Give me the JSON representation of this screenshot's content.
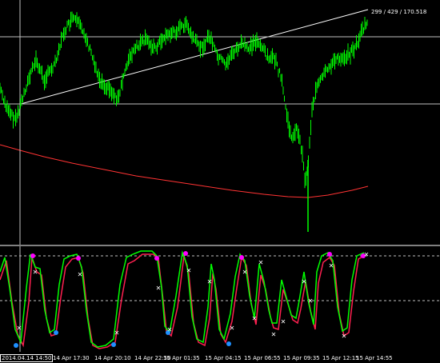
{
  "crosshair": {
    "readout": "299 / 429 / 170.518"
  },
  "time_axis": {
    "labels": [
      "2014.04.14 14:50",
      "14 Apr 17:30",
      "14 Apr 20:10",
      "14 Apr 22:50",
      "15 Apr 01:35",
      "15 Apr 04:15",
      "15 Apr 06:55",
      "15 Apr 09:35",
      "15 Apr 12:15",
      "15 Apr 14:55"
    ]
  },
  "colors": {
    "background": "#000000",
    "price_bars": "#00ff00",
    "moving_average": "#ff3333",
    "crosshair": "#c0c0c0",
    "trendline": "#ffffff",
    "osc_fast": "#00ff00",
    "osc_slow": "#ff2050",
    "signal_magenta": "#ff00ff",
    "signal_blue": "#1e90ff",
    "signal_cross": "#ffffff"
  }
}
